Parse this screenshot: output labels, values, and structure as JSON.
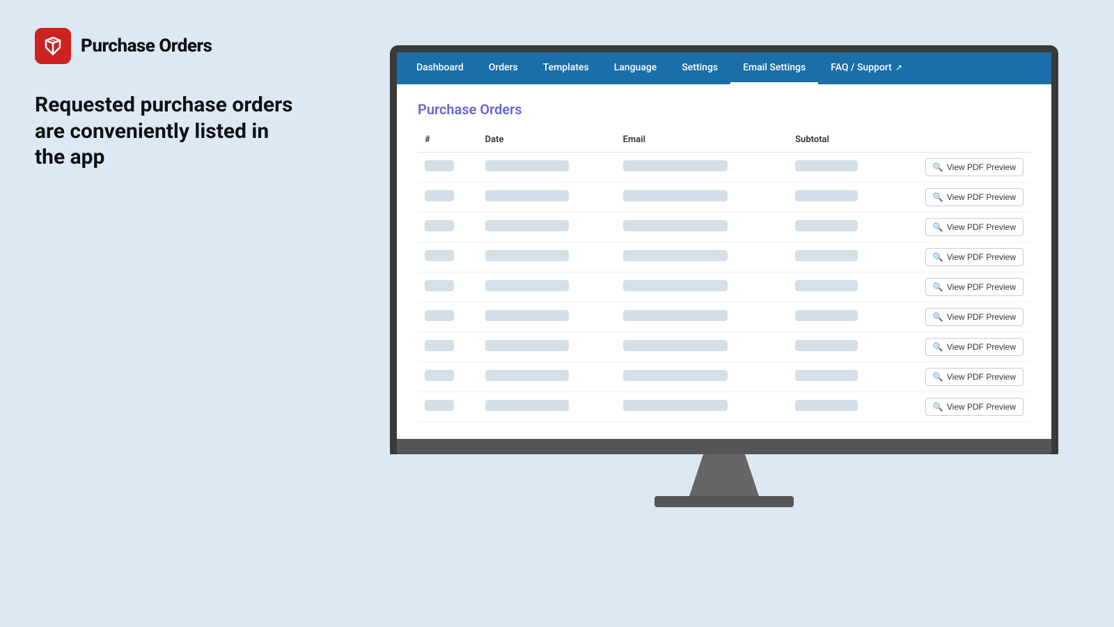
{
  "brand": {
    "name": "Purchase Orders"
  },
  "tagline": "Requested purchase orders are conveniently listed in the app",
  "nav": {
    "items": [
      {
        "label": "Dashboard",
        "active": false
      },
      {
        "label": "Orders",
        "active": false
      },
      {
        "label": "Templates",
        "active": false
      },
      {
        "label": "Language",
        "active": false
      },
      {
        "label": "Settings",
        "active": false
      },
      {
        "label": "Email Settings",
        "active": true
      },
      {
        "label": "FAQ / Support",
        "active": false,
        "external": true
      }
    ]
  },
  "page": {
    "title": "Purchase Orders"
  },
  "table": {
    "columns": [
      "#",
      "Date",
      "Email",
      "Subtotal"
    ],
    "rows": 9,
    "action_label": "View PDF Preview"
  }
}
